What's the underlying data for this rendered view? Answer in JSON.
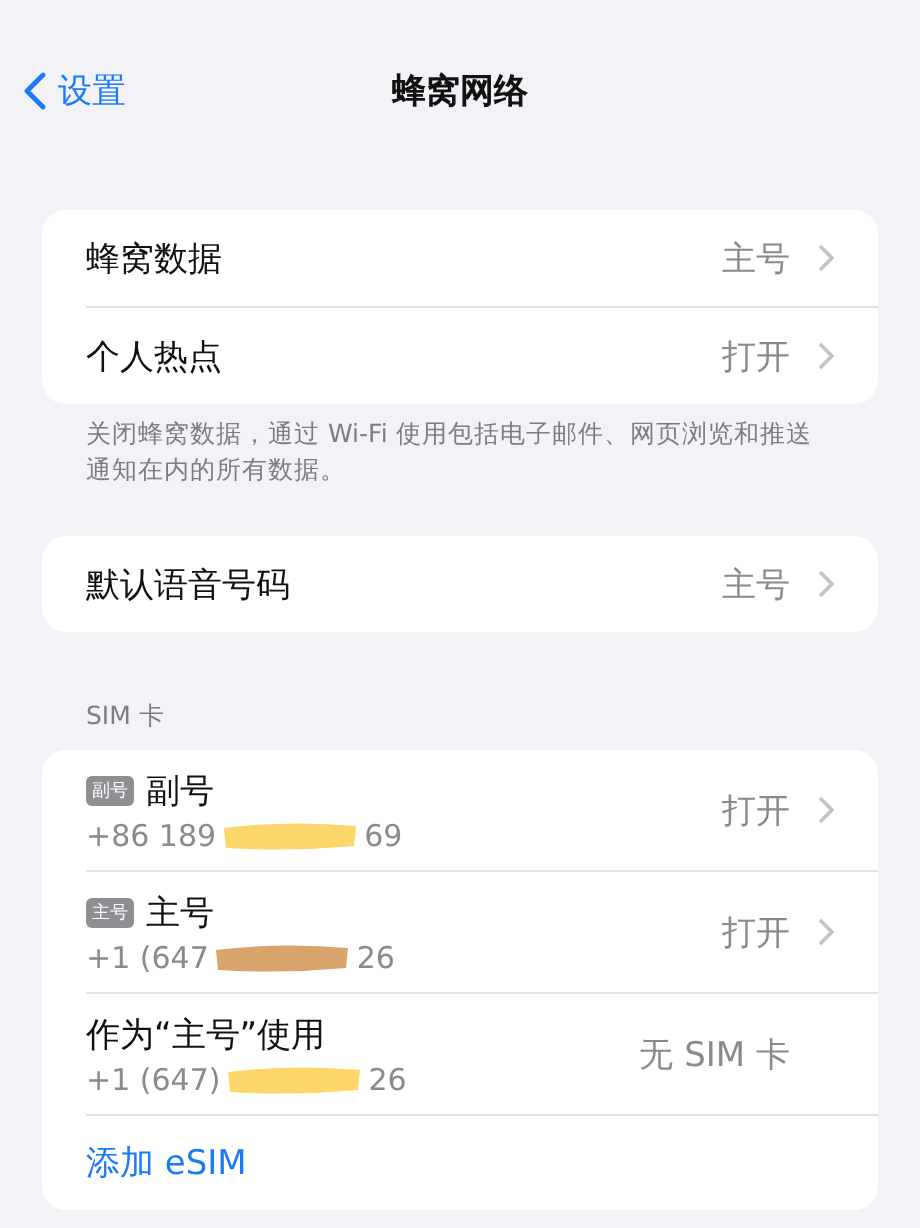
{
  "nav": {
    "back": "设置",
    "title": "蜂窝网络"
  },
  "groups": [
    {
      "rows": [
        {
          "kind": "detail",
          "label": "蜂窝数据",
          "value": "主号",
          "chevron": true
        },
        {
          "kind": "detail",
          "label": "个人热点",
          "value": "打开",
          "chevron": true
        }
      ],
      "footer": "关闭蜂窝数据，通过 Wi-Fi 使用包括电子邮件、网页浏览和推送通知在内的所有数据。"
    },
    {
      "rows": [
        {
          "kind": "detail",
          "label": "默认语音号码",
          "value": "主号",
          "chevron": true
        }
      ]
    },
    {
      "header": "SIM 卡",
      "rows": [
        {
          "kind": "sim",
          "badge": "副号",
          "label": "副号",
          "number_start": "+86 189",
          "number_end": "69",
          "color": "#fdd76a",
          "value": "打开",
          "chevron": true
        },
        {
          "kind": "sim",
          "badge": "主号",
          "label": "主号",
          "number_start": "+1 (647",
          "number_end": "26",
          "color": "#d9a46c",
          "value": "打开",
          "chevron": true
        },
        {
          "kind": "sim",
          "label": "作为“主号”使用",
          "number_start": "+1 (647)",
          "number_end": "26",
          "color": "#fdd76a",
          "value": "无 SIM 卡",
          "chevron": false
        },
        {
          "kind": "link",
          "label": "添加 eSIM"
        }
      ]
    }
  ]
}
